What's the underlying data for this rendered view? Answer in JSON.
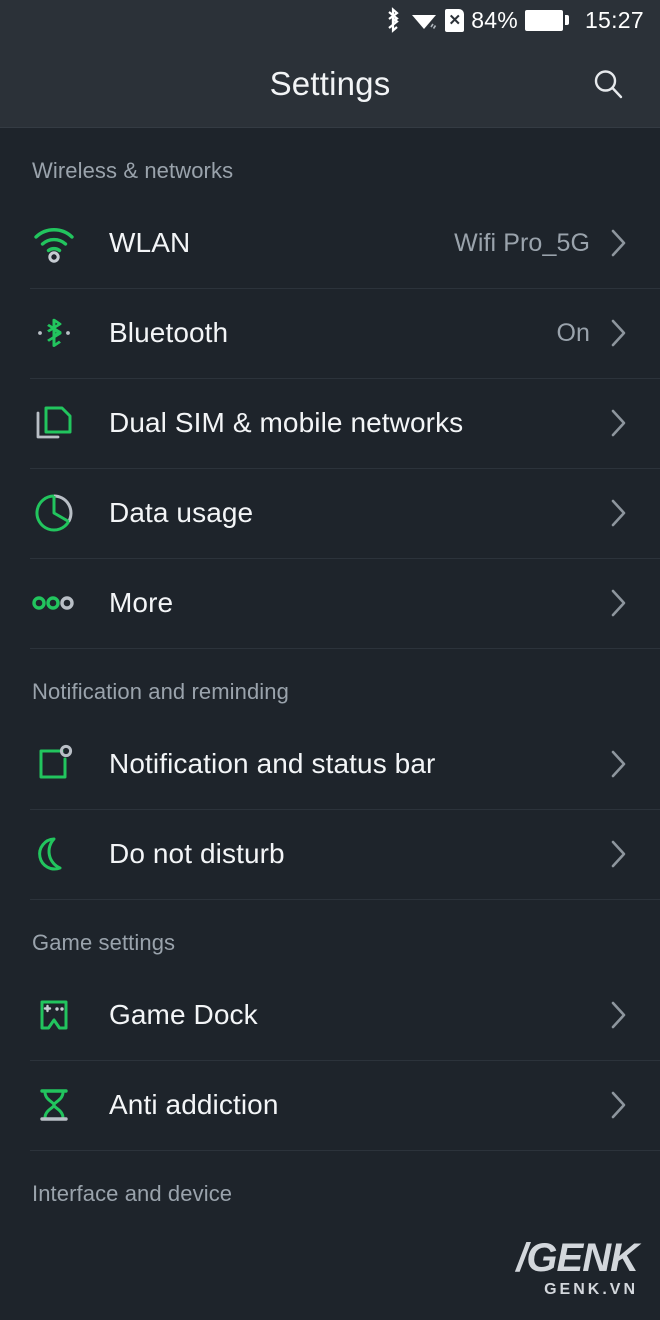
{
  "status_bar": {
    "bluetooth_icon": "bluetooth-icon",
    "wifi_icon": "wifi-icon",
    "sim_icon_label": "x",
    "battery_percent": "84%",
    "battery_icon": "battery-icon",
    "clock": "15:27"
  },
  "app_bar": {
    "title": "Settings",
    "search_icon": "search-icon"
  },
  "colors": {
    "accent_green": "#22c55e",
    "icon_gray": "#b9bfc6",
    "background": "#1e242b",
    "bar_background": "#2b3138",
    "text_primary": "#f3f5f7",
    "text_secondary": "#9aa3ac"
  },
  "sections": [
    {
      "header": "Wireless & networks",
      "items": [
        {
          "icon": "wifi-icon",
          "label": "WLAN",
          "value": "Wifi Pro_5G",
          "chevron": "chevron-right-icon"
        },
        {
          "icon": "bluetooth-icon",
          "label": "Bluetooth",
          "value": "On",
          "chevron": "chevron-right-icon"
        },
        {
          "icon": "dual-sim-icon",
          "label": "Dual SIM & mobile networks",
          "value": "",
          "chevron": "chevron-right-icon"
        },
        {
          "icon": "pie-chart-icon",
          "label": "Data usage",
          "value": "",
          "chevron": "chevron-right-icon"
        },
        {
          "icon": "more-dots-icon",
          "label": "More",
          "value": "",
          "chevron": "chevron-right-icon"
        }
      ]
    },
    {
      "header": "Notification and reminding",
      "items": [
        {
          "icon": "notification-badge-icon",
          "label": "Notification and status bar",
          "value": "",
          "chevron": "chevron-right-icon"
        },
        {
          "icon": "moon-icon",
          "label": "Do not disturb",
          "value": "",
          "chevron": "chevron-right-icon"
        }
      ]
    },
    {
      "header": "Game settings",
      "items": [
        {
          "icon": "gamepad-icon",
          "label": "Game Dock",
          "value": "",
          "chevron": "chevron-right-icon"
        },
        {
          "icon": "hourglass-icon",
          "label": "Anti addiction",
          "value": "",
          "chevron": "chevron-right-icon"
        }
      ]
    },
    {
      "header": "Interface and device",
      "items": []
    }
  ],
  "watermark": {
    "logo": "/GENK",
    "site": "GENK.VN"
  }
}
